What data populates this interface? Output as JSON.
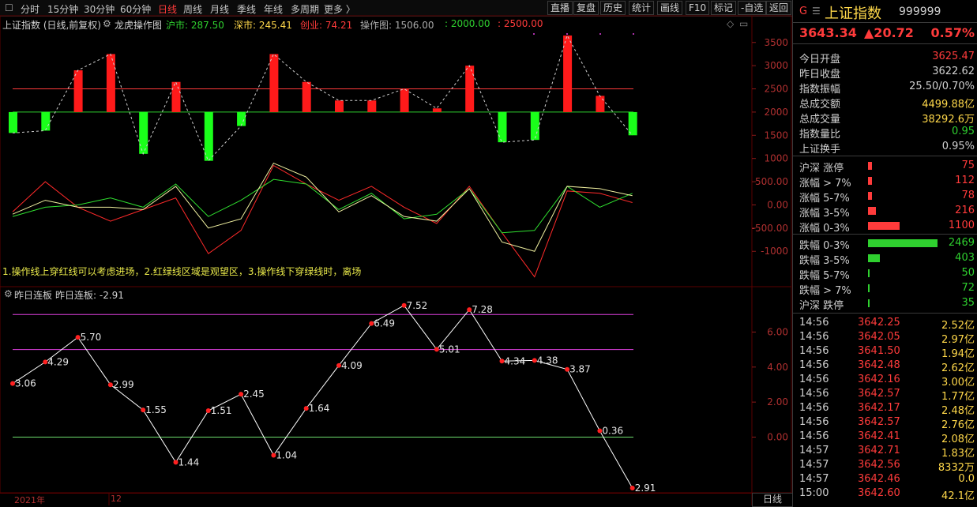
{
  "toolbar": {
    "timeframes": [
      "分时",
      "15分钟",
      "30分钟",
      "60分钟",
      "日线",
      "周线",
      "月线",
      "季线",
      "年线",
      "多周期",
      "更多 〉"
    ],
    "active": "日线",
    "buttons": [
      "直播",
      "复盘",
      "历史",
      "统计",
      "画线",
      "F10",
      "标记",
      "-自选",
      "返回"
    ]
  },
  "panel1": {
    "title": "上证指数 (日线,前复权)",
    "indicator": "龙虎操作图",
    "sh_label": "沪市: 287.50",
    "sz_label": "深市: 245.41",
    "cy_label": "创业: 74.21",
    "op_label": "操作图: 1506.00",
    "l1_label": ": 2000.00",
    "l2_label": ": 2500.00",
    "note": "1.操作线上穿红线可以考虑进场，2.红绿线区域是观望区，3.操作线下穿绿线时，离场",
    "axis_ticks": [
      "3500",
      "3000",
      "2500",
      "2000",
      "1500",
      "1000",
      "500.00",
      "0.00",
      "-500.00",
      "-1000"
    ]
  },
  "panel2": {
    "title": "昨日连板",
    "value_label": "昨日连板: -2.91",
    "axis_ticks": [
      "6.00",
      "4.00",
      "2.00",
      "0.00"
    ]
  },
  "bottom": {
    "year": "2021年",
    "month": "12",
    "period": "日线"
  },
  "chart_data": [
    {
      "type": "bar",
      "name_hint": "龙虎操作图",
      "baseline": 2000,
      "ylim": [
        -1200,
        3700
      ],
      "lines": [
        2000,
        2500
      ],
      "values": [
        1550,
        1600,
        2900,
        3250,
        1100,
        2650,
        950,
        1700,
        3250,
        2650,
        2250,
        2250,
        2500,
        2080,
        3000,
        1350,
        1400,
        3650,
        2350,
        1500
      ],
      "dashed_connector": true,
      "lower_lines": {
        "red": [
          -150,
          500,
          -50,
          -350,
          -100,
          150,
          -1050,
          -550,
          850,
          450,
          100,
          400,
          -50,
          -400,
          400,
          -600,
          -1550,
          300,
          250,
          50
        ],
        "green": [
          -250,
          -50,
          0,
          150,
          -50,
          450,
          -250,
          100,
          550,
          450,
          -100,
          250,
          -300,
          -200,
          350,
          -600,
          -550,
          400,
          -50,
          250
        ],
        "yellow": [
          -200,
          100,
          -50,
          -50,
          -100,
          400,
          -500,
          -300,
          900,
          600,
          -150,
          200,
          -250,
          -350,
          350,
          -800,
          -1000,
          400,
          350,
          200
        ]
      }
    },
    {
      "type": "line",
      "name_hint": "昨日连板",
      "ylim": [
        -3.0,
        7.6
      ],
      "hlines": [
        0,
        5.0,
        7.0
      ],
      "values": [
        3.06,
        4.29,
        5.7,
        2.99,
        1.55,
        -1.44,
        1.51,
        2.45,
        -1.04,
        1.64,
        4.09,
        6.49,
        7.52,
        5.01,
        7.28,
        4.34,
        4.38,
        3.87,
        0.36,
        -2.91
      ],
      "labels": [
        "3.06",
        "4.29",
        "5.70",
        "2.99",
        "1.55",
        "1.44",
        "1.51",
        "2.45",
        "1.04",
        "1.64",
        "4.09",
        "6.49",
        "7.52",
        "5.01",
        "7.28",
        "4.34",
        "4.38",
        "3.87",
        "0.36",
        "2.91"
      ]
    }
  ],
  "quote": {
    "g": "G",
    "menu": "☰",
    "name": "上证指数",
    "code": "999999",
    "price": "3643.34",
    "change": "▲20.72",
    "pct": "0.57%",
    "stats": [
      {
        "label": "今日开盘",
        "value": "3625.47",
        "color": "#ff3b3b"
      },
      {
        "label": "昨日收盘",
        "value": "3622.62",
        "color": "#d0d0d0"
      },
      {
        "label": "指数振幅",
        "value": "25.50/0.70%",
        "color": "#d0d0d0"
      },
      {
        "label": "总成交额",
        "value": "4499.88亿",
        "color": "#ffd84a"
      },
      {
        "label": "总成交量",
        "value": "38292.6万",
        "color": "#ffd84a"
      },
      {
        "label": "指数量比",
        "value": "0.95",
        "color": "#2fd02f"
      },
      {
        "label": "上证换手",
        "value": "0.95%",
        "color": "#d0d0d0"
      }
    ],
    "breadth": [
      {
        "label": "沪深 涨停",
        "value": "75",
        "color": "#ff3b3b",
        "bar": 5
      },
      {
        "label": "涨幅 > 7%",
        "value": "112",
        "color": "#ff3b3b",
        "bar": 5
      },
      {
        "label": "涨幅 5-7%",
        "value": "78",
        "color": "#ff3b3b",
        "bar": 5
      },
      {
        "label": "涨幅 3-5%",
        "value": "216",
        "color": "#ff3b3b",
        "bar": 10
      },
      {
        "label": "涨幅 0-3%",
        "value": "1100",
        "color": "#ff3b3b",
        "bar": 40
      },
      {
        "label": "跌幅 0-3%",
        "value": "2469",
        "color": "#2fd02f",
        "bar": 88
      },
      {
        "label": "跌幅 3-5%",
        "value": "403",
        "color": "#2fd02f",
        "bar": 15
      },
      {
        "label": "跌幅 5-7%",
        "value": "50",
        "color": "#2fd02f",
        "bar": 2
      },
      {
        "label": "跌幅 > 7%",
        "value": "72",
        "color": "#2fd02f",
        "bar": 2
      },
      {
        "label": "沪深 跌停",
        "value": "35",
        "color": "#2fd02f",
        "bar": 2
      }
    ],
    "ticks": [
      {
        "t": "14:56",
        "p": "3642.25",
        "a": "2.52亿"
      },
      {
        "t": "14:56",
        "p": "3642.05",
        "a": "2.97亿"
      },
      {
        "t": "14:56",
        "p": "3641.50",
        "a": "1.94亿"
      },
      {
        "t": "14:56",
        "p": "3642.48",
        "a": "2.62亿"
      },
      {
        "t": "14:56",
        "p": "3642.16",
        "a": "3.00亿"
      },
      {
        "t": "14:56",
        "p": "3642.57",
        "a": "1.77亿"
      },
      {
        "t": "14:56",
        "p": "3642.17",
        "a": "2.48亿"
      },
      {
        "t": "14:56",
        "p": "3642.57",
        "a": "2.76亿"
      },
      {
        "t": "14:56",
        "p": "3642.41",
        "a": "2.08亿"
      },
      {
        "t": "14:57",
        "p": "3642.71",
        "a": "1.83亿"
      },
      {
        "t": "14:57",
        "p": "3642.56",
        "a": "8332万"
      },
      {
        "t": "14:57",
        "p": "3642.46",
        "a": "0.0"
      },
      {
        "t": "15:00",
        "p": "3642.60",
        "a": "42.1亿"
      }
    ]
  }
}
